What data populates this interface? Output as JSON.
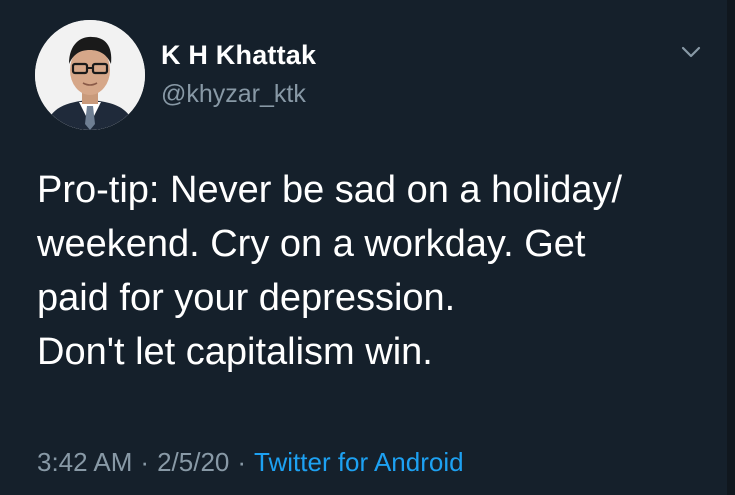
{
  "author": {
    "display_name": "K H Khattak",
    "handle": "@khyzar_ktk"
  },
  "tweet": {
    "lines": [
      "Pro-tip: Never be sad on a holiday/",
      "weekend. Cry on a workday. Get",
      "paid for your depression.",
      "Don't let capitalism win."
    ],
    "time": "3:42 AM",
    "date": "2/5/20",
    "separator": "·",
    "source": "Twitter for Android"
  },
  "icons": {
    "menu": "chevron-down-icon"
  },
  "colors": {
    "background": "#15202b",
    "text": "#ffffff",
    "secondary_text": "#8899a6",
    "link": "#1da1f2"
  }
}
